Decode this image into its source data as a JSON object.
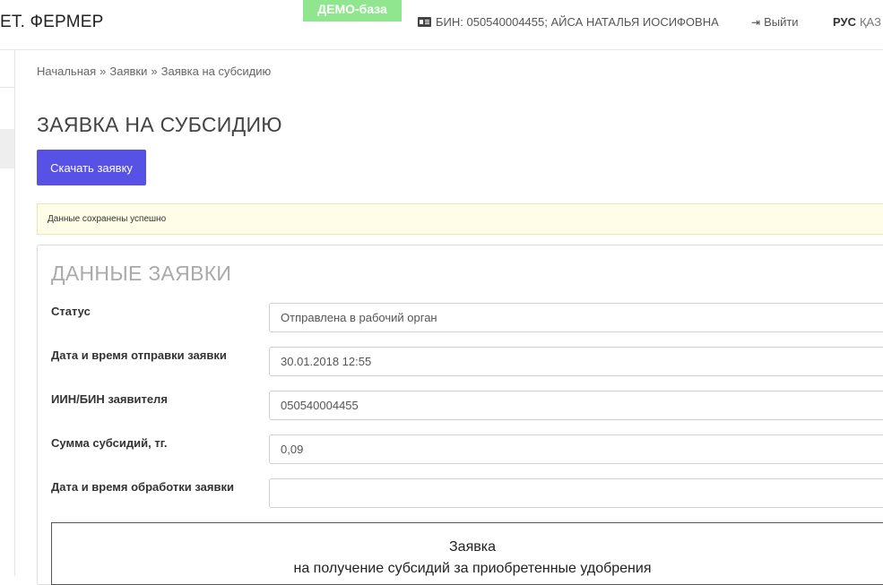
{
  "header": {
    "brand": "ЕТ. ФЕРМЕР",
    "demo_badge": "ДЕМО-база",
    "user_info": "БИН: 050540004455; АЙСА НАТАЛЬЯ ИОСИФОВНА",
    "user_icon": "id-card-icon",
    "logout_label": "Выйти",
    "logout_icon": "sign-out-icon",
    "lang_active": "РУС",
    "lang_other": "ҚАЗ"
  },
  "breadcrumb": {
    "items": [
      "Начальная",
      "Заявки",
      "Заявка на субсидию"
    ],
    "separator": "»"
  },
  "page": {
    "title": "ЗАЯВКА НА СУБСИДИЮ",
    "download_button": "Скачать заявку",
    "alert": "Данные сохранены успешно"
  },
  "panel": {
    "title": "ДАННЫЕ ЗАЯВКИ",
    "fields": [
      {
        "label": "Статус",
        "value": "Отправлена в рабочий орган"
      },
      {
        "label": "Дата и время отправки заявки",
        "value": "30.01.2018 12:55"
      },
      {
        "label": "ИИН/БИН заявителя",
        "value": "050540004455"
      },
      {
        "label": "Сумма субсидий, тг.",
        "value": "0,09"
      },
      {
        "label": "Дата и время обработки заявки",
        "value": ""
      }
    ]
  },
  "document": {
    "title": "Заявка",
    "subtitle": "на получение субсидий за приобретенные удобрения"
  },
  "colors": {
    "primary_button": "#5751e6",
    "demo_badge": "#8fe68f",
    "alert_bg": "#fffde8"
  }
}
